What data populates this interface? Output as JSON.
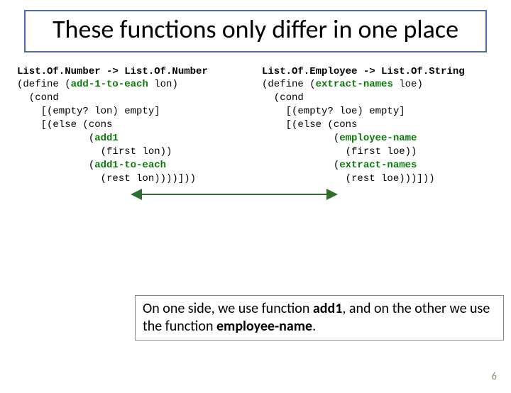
{
  "title": "These functions only differ in one place",
  "left": {
    "sig": "List.Of.Number -> List.Of.Number",
    "def_open": "(define (",
    "def_name": "add-1-to-each",
    "def_rest": " lon)",
    "l2": "  (cond",
    "l3": "    [(empty? lon) empty]",
    "l4": "    [(else (cons",
    "l5a": "            (",
    "l5_fn": "add1",
    "l6": "              (first lon))",
    "l7a": "            (",
    "l7_fn": "add1-to-each",
    "l8": "              (rest lon))))]))"
  },
  "right": {
    "sig": "List.Of.Employee -> List.Of.String",
    "def_open": "(define (",
    "def_name": "extract-names",
    "def_rest": " loe)",
    "l2": "  (cond",
    "l3": "    [(empty? loe) empty]",
    "l4": "    [(else (cons",
    "l5a": "            (",
    "l5_fn": "employee-name",
    "l6": "              (first loe))",
    "l7a": "            (",
    "l7_fn": "extract-names",
    "l8": "              (rest loe)))]))"
  },
  "note": {
    "t1": "On one side, we use function ",
    "b1": "add1",
    "t2": ", and on the other we use the function ",
    "b2": "employee-name",
    "t3": "."
  },
  "page": "6"
}
